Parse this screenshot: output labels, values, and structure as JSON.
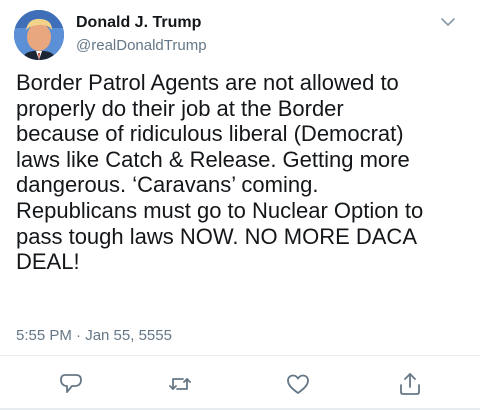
{
  "tweet": {
    "author": {
      "name": "Donald J. Trump",
      "handle": "@realDonaldTrump",
      "avatar_icon": "profile-photo"
    },
    "text": "Border Patrol Agents are not allowed to\nproperly do their job at the Border\nbecause of ridiculous liberal (Democrat)\nlaws like Catch & Release. Getting more\ndangerous. ‘Caravans’ coming.\nRepublicans must go to Nuclear Option to\npass tough laws NOW. NO MORE DACA\nDEAL!",
    "timestamp": "5:55 PM · Jan 55, 5555",
    "menu_icon": "chevron-down-icon",
    "actions": [
      {
        "name": "reply",
        "icon": "reply-icon"
      },
      {
        "name": "retweet",
        "icon": "retweet-icon"
      },
      {
        "name": "like",
        "icon": "heart-icon"
      },
      {
        "name": "share",
        "icon": "share-icon"
      }
    ],
    "colors": {
      "text": "#14171a",
      "secondary": "#657786",
      "icon": "#657786",
      "divider": "#e6ecf0"
    }
  }
}
